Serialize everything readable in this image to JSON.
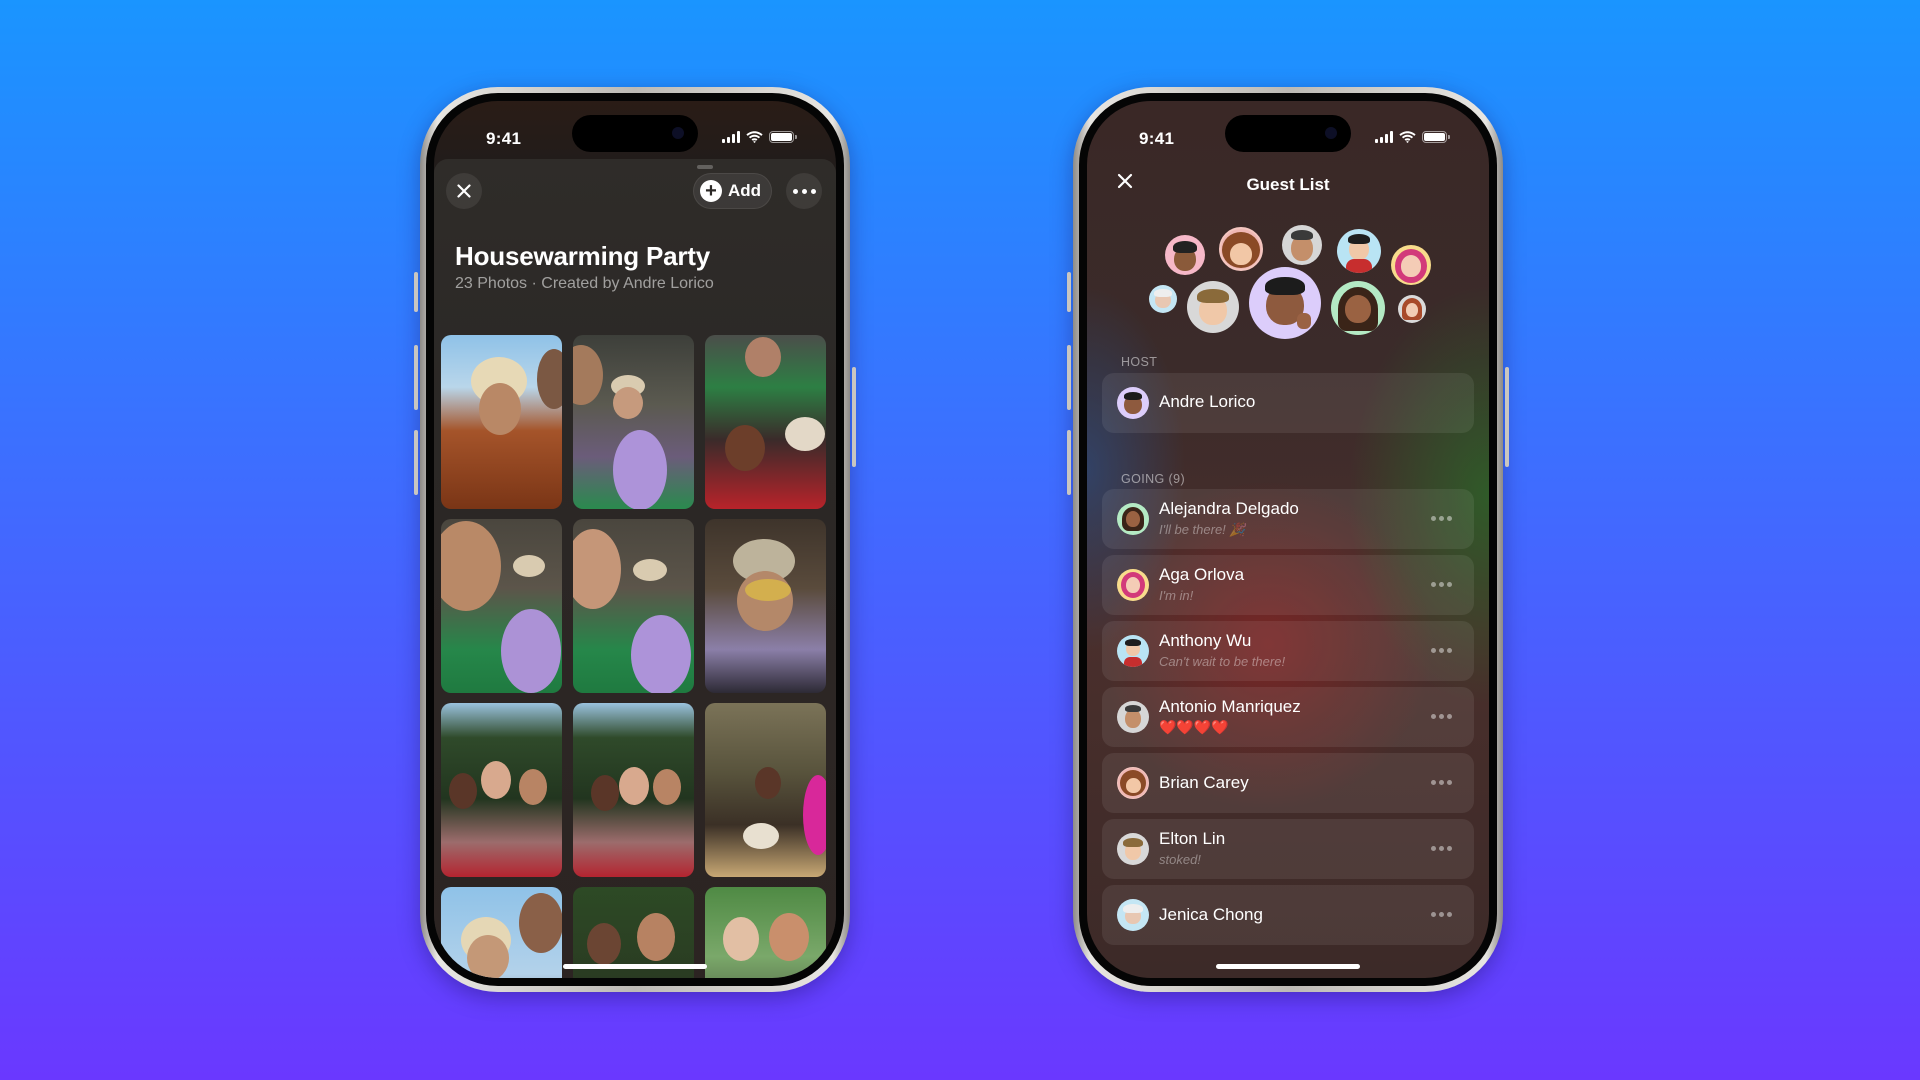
{
  "background": {
    "top_color": "#1a95ff",
    "bottom_color": "#6a38ff"
  },
  "left_phone": {
    "status_bar": {
      "time": "9:41",
      "icons": [
        "cellular-signal-icon",
        "wifi-icon",
        "battery-icon"
      ]
    },
    "toolbar": {
      "close_icon": "close-icon",
      "add_label": "Add",
      "add_icon": "plus-circle-icon",
      "more_icon": "ellipsis-icon"
    },
    "album": {
      "title": "Housewarming Party",
      "subtitle": "23 Photos · Created by Andre Lorico",
      "photo_count": 23
    },
    "photos": [
      {
        "desc": "Selfie of friends, woman in orange fur coat"
      },
      {
        "desc": "Group selfie, man in beanie with purple pants"
      },
      {
        "desc": "Friends in green and red jackets"
      },
      {
        "desc": "Laughing selfie with man in beanie"
      },
      {
        "desc": "Laughing selfie with man in beanie, variant"
      },
      {
        "desc": "Man in beanie with yellow sunglasses"
      },
      {
        "desc": "Three women under trees"
      },
      {
        "desc": "Three women under trees, peace sign"
      },
      {
        "desc": "Friends at dinner table"
      },
      {
        "desc": "Selfie of friends under blue sky"
      },
      {
        "desc": "Two women close-up"
      },
      {
        "desc": "Two women by window"
      }
    ]
  },
  "right_phone": {
    "status_bar": {
      "time": "9:41",
      "icons": [
        "cellular-signal-icon",
        "wifi-icon",
        "battery-icon"
      ]
    },
    "header": {
      "title": "Guest List",
      "close_icon": "close-icon"
    },
    "avatar_cluster": [
      {
        "name": "Antonio Manriquez",
        "bg": "#f6b8c8"
      },
      {
        "name": "Brian Carey",
        "bg": "#f0b8b4"
      },
      {
        "name": "Antonio Manriquez",
        "bg": "#d6d6d6"
      },
      {
        "name": "Anthony Wu",
        "bg": "#b9e4f4"
      },
      {
        "name": "Aga Orlova",
        "bg": "#f8dc8c"
      },
      {
        "name": "Jenica Chong",
        "bg": "#c4e6f4"
      },
      {
        "name": "Elton Lin",
        "bg": "#d8d8d8"
      },
      {
        "name": "Andre Lorico",
        "bg": "#dccdfb"
      },
      {
        "name": "Alejandra Delgado",
        "bg": "#b4eac4"
      },
      {
        "name": "Guest",
        "bg": "#dadada"
      }
    ],
    "host_section": {
      "label": "HOST",
      "host": {
        "name": "Andre Lorico"
      }
    },
    "going_section": {
      "label": "GOING (9)",
      "count": 9,
      "guests": [
        {
          "name": "Alejandra Delgado",
          "status": "I'll be there! 🎉"
        },
        {
          "name": "Aga Orlova",
          "status": "I'm in!"
        },
        {
          "name": "Anthony Wu",
          "status": "Can't wait to be there!"
        },
        {
          "name": "Antonio Manriquez",
          "status": "❤️❤️❤️❤️"
        },
        {
          "name": "Brian Carey",
          "status": ""
        },
        {
          "name": "Elton Lin",
          "status": "stoked!"
        },
        {
          "name": "Jenica Chong",
          "status": ""
        }
      ]
    }
  }
}
